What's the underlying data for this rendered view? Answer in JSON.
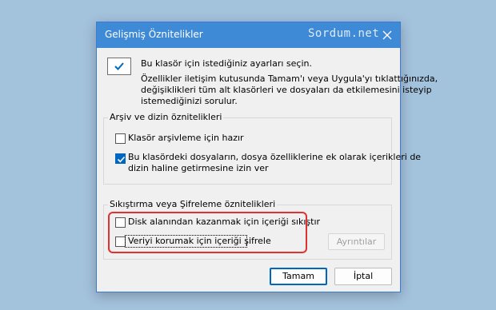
{
  "dialog": {
    "title": "Gelişmiş Öznitelikler",
    "watermark": "Sordum.net",
    "close_icon": "close-icon"
  },
  "header": {
    "icon": "checkbox-check-icon",
    "line1": "Bu klasör için istediğiniz ayarları seçin.",
    "description": [
      "Özellikler iletişim kutusunda Tamam'ı veya Uygula'yı tıklattığınızda,",
      "değişiklikleri tüm alt klasörleri ve dosyaları da etkilemesini isteyip",
      "istemediğinizi sorulur."
    ]
  },
  "archive_group": {
    "title": "Arşiv ve dizin öznitelikleri",
    "archive_checkbox": {
      "label": "Klasör arşivleme için hazır",
      "checked": false
    },
    "index_checkbox": {
      "label_line1": "Bu klasördeki dosyaların, dosya özelliklerine ek olarak içerikleri de",
      "label_line2": "dizin haline getirmesine izin ver",
      "checked": true
    }
  },
  "compress_group": {
    "title": "Sıkıştırma veya Şifreleme öznitelikleri",
    "compress_checkbox": {
      "label": "Disk alanından kazanmak için içeriği sıkıştır",
      "checked": false
    },
    "encrypt_checkbox": {
      "label": "Veriyi korumak için içeriği şifrele",
      "checked": false
    },
    "details_button": "Ayrıntılar"
  },
  "footer": {
    "ok_button": "Tamam",
    "cancel_button": "İptal"
  },
  "colors": {
    "titlebar": "#3f8ad6",
    "accent": "#0067c0",
    "highlight": "#e03030",
    "desktop": "#a3c2dc"
  }
}
